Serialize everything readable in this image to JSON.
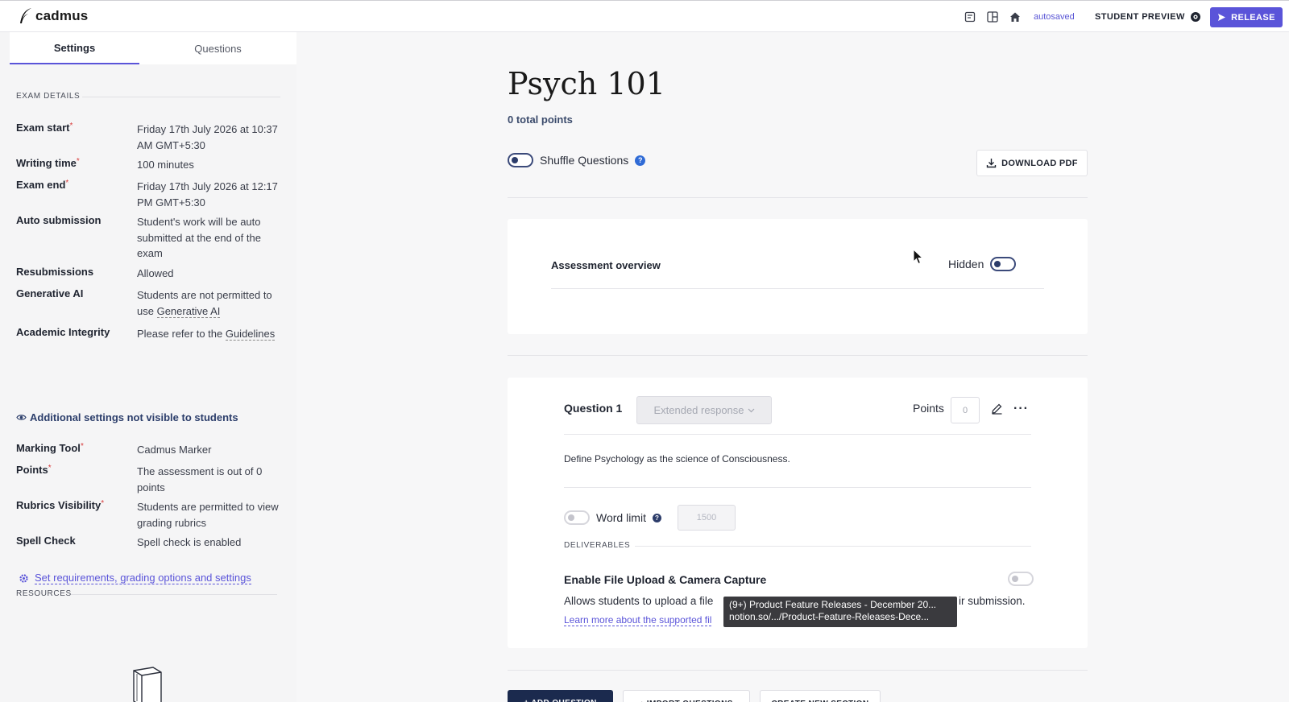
{
  "header": {
    "logo_text": "cadmus",
    "autosaved": "autosaved",
    "student_preview": "STUDENT PREVIEW",
    "release": "RELEASE",
    "accent_color": "#5a54d9",
    "icons": [
      "notes-icon",
      "layout-icon",
      "home-icon"
    ]
  },
  "sidebar": {
    "tabs": [
      {
        "label": "Settings",
        "active": true
      },
      {
        "label": "Questions",
        "active": false
      }
    ],
    "exam_details_title": "EXAM DETAILS",
    "details": [
      {
        "label": "Exam start",
        "required": true,
        "value": "Friday 17th July 2026 at 10:37 AM GMT+5:30"
      },
      {
        "label": "Writing time",
        "required": true,
        "value": "100 minutes"
      },
      {
        "label": "Exam end",
        "required": true,
        "value": "Friday 17th July 2026 at 12:17 PM GMT+5:30"
      },
      {
        "label": "Auto submission",
        "required": false,
        "value": "Student's work will be auto submitted at the end of the exam"
      },
      {
        "label": "Resubmissions",
        "required": false,
        "value": "Allowed"
      },
      {
        "label": "Generative AI",
        "required": false,
        "value_pre": "Students are not permitted to use ",
        "value_link": "Generative AI"
      },
      {
        "label": "Academic Integrity",
        "required": false,
        "value_pre": "Please refer to the ",
        "value_link": "Guidelines"
      }
    ],
    "additional_title": "Additional settings not visible to students",
    "additional": [
      {
        "label": "Marking Tool",
        "required": true,
        "value": "Cadmus Marker"
      },
      {
        "label": "Points",
        "required": true,
        "value": "The assessment is out of 0 points"
      },
      {
        "label": "Rubrics Visibility",
        "required": true,
        "value": "Students are permitted to view grading rubrics"
      },
      {
        "label": "Spell Check",
        "required": false,
        "value": "Spell check is enabled"
      }
    ],
    "set_requirements": "Set requirements, grading options and settings",
    "resources_title": "RESOURCES",
    "required_mark": "*"
  },
  "main": {
    "title": "Psych 101",
    "total_points": "0 total points",
    "shuffle_label": "Shuffle Questions",
    "shuffle_on": false,
    "help_glyph": "?",
    "download_pdf": "DOWNLOAD PDF",
    "overview": {
      "title": "Assessment overview",
      "visibility_label": "Hidden",
      "visible": false
    },
    "question": {
      "title": "Question 1",
      "type": "Extended response",
      "points_label": "Points",
      "points_value": "0",
      "more_glyph": "···",
      "text": "Define Psychology as the science of Consciousness.",
      "word_limit_label": "Word limit",
      "word_limit_value": "1500",
      "word_limit_on": false,
      "deliverables_title": "DELIVERABLES",
      "upload_title": "Enable File Upload & Camera Capture",
      "upload_on": false,
      "upload_desc_start": "Allows students to upload a file",
      "upload_desc_end": "ir submission.",
      "learn_more": "Learn more about the supported fil"
    },
    "tooltip": {
      "line1": "(9+) Product Feature Releases - December 20...",
      "line2": "notion.so/.../Product-Feature-Releases-Dece..."
    },
    "buttons": {
      "add_question": "+ ADD QUESTION",
      "import_questions": "↓ IMPORT QUESTIONS",
      "create_section": "CREATE NEW SECTION"
    }
  }
}
